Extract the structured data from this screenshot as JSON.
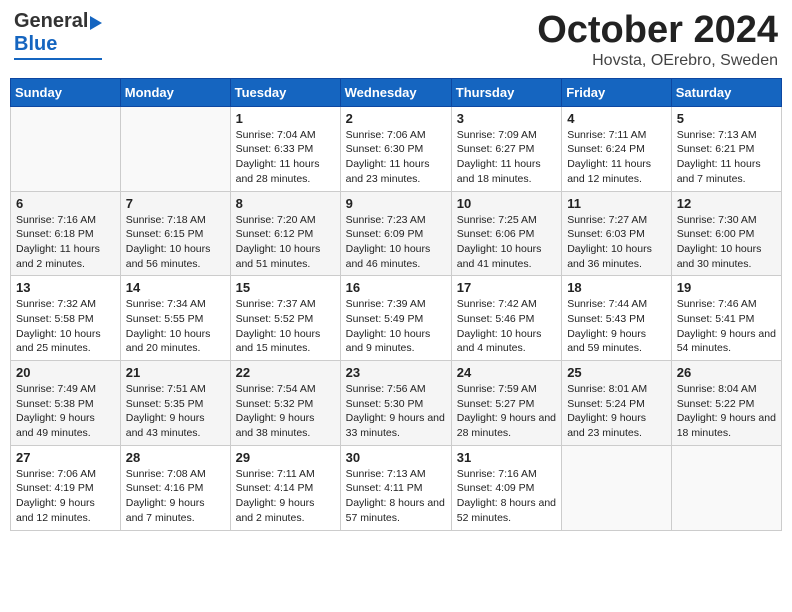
{
  "header": {
    "logo_general": "General",
    "logo_blue": "Blue",
    "month_title": "October 2024",
    "subtitle": "Hovsta, OErebro, Sweden"
  },
  "calendar": {
    "days_of_week": [
      "Sunday",
      "Monday",
      "Tuesday",
      "Wednesday",
      "Thursday",
      "Friday",
      "Saturday"
    ],
    "weeks": [
      [
        {
          "day": "",
          "sunrise": "",
          "sunset": "",
          "daylight": ""
        },
        {
          "day": "",
          "sunrise": "",
          "sunset": "",
          "daylight": ""
        },
        {
          "day": "1",
          "sunrise": "Sunrise: 7:04 AM",
          "sunset": "Sunset: 6:33 PM",
          "daylight": "Daylight: 11 hours and 28 minutes."
        },
        {
          "day": "2",
          "sunrise": "Sunrise: 7:06 AM",
          "sunset": "Sunset: 6:30 PM",
          "daylight": "Daylight: 11 hours and 23 minutes."
        },
        {
          "day": "3",
          "sunrise": "Sunrise: 7:09 AM",
          "sunset": "Sunset: 6:27 PM",
          "daylight": "Daylight: 11 hours and 18 minutes."
        },
        {
          "day": "4",
          "sunrise": "Sunrise: 7:11 AM",
          "sunset": "Sunset: 6:24 PM",
          "daylight": "Daylight: 11 hours and 12 minutes."
        },
        {
          "day": "5",
          "sunrise": "Sunrise: 7:13 AM",
          "sunset": "Sunset: 6:21 PM",
          "daylight": "Daylight: 11 hours and 7 minutes."
        }
      ],
      [
        {
          "day": "6",
          "sunrise": "Sunrise: 7:16 AM",
          "sunset": "Sunset: 6:18 PM",
          "daylight": "Daylight: 11 hours and 2 minutes."
        },
        {
          "day": "7",
          "sunrise": "Sunrise: 7:18 AM",
          "sunset": "Sunset: 6:15 PM",
          "daylight": "Daylight: 10 hours and 56 minutes."
        },
        {
          "day": "8",
          "sunrise": "Sunrise: 7:20 AM",
          "sunset": "Sunset: 6:12 PM",
          "daylight": "Daylight: 10 hours and 51 minutes."
        },
        {
          "day": "9",
          "sunrise": "Sunrise: 7:23 AM",
          "sunset": "Sunset: 6:09 PM",
          "daylight": "Daylight: 10 hours and 46 minutes."
        },
        {
          "day": "10",
          "sunrise": "Sunrise: 7:25 AM",
          "sunset": "Sunset: 6:06 PM",
          "daylight": "Daylight: 10 hours and 41 minutes."
        },
        {
          "day": "11",
          "sunrise": "Sunrise: 7:27 AM",
          "sunset": "Sunset: 6:03 PM",
          "daylight": "Daylight: 10 hours and 36 minutes."
        },
        {
          "day": "12",
          "sunrise": "Sunrise: 7:30 AM",
          "sunset": "Sunset: 6:00 PM",
          "daylight": "Daylight: 10 hours and 30 minutes."
        }
      ],
      [
        {
          "day": "13",
          "sunrise": "Sunrise: 7:32 AM",
          "sunset": "Sunset: 5:58 PM",
          "daylight": "Daylight: 10 hours and 25 minutes."
        },
        {
          "day": "14",
          "sunrise": "Sunrise: 7:34 AM",
          "sunset": "Sunset: 5:55 PM",
          "daylight": "Daylight: 10 hours and 20 minutes."
        },
        {
          "day": "15",
          "sunrise": "Sunrise: 7:37 AM",
          "sunset": "Sunset: 5:52 PM",
          "daylight": "Daylight: 10 hours and 15 minutes."
        },
        {
          "day": "16",
          "sunrise": "Sunrise: 7:39 AM",
          "sunset": "Sunset: 5:49 PM",
          "daylight": "Daylight: 10 hours and 9 minutes."
        },
        {
          "day": "17",
          "sunrise": "Sunrise: 7:42 AM",
          "sunset": "Sunset: 5:46 PM",
          "daylight": "Daylight: 10 hours and 4 minutes."
        },
        {
          "day": "18",
          "sunrise": "Sunrise: 7:44 AM",
          "sunset": "Sunset: 5:43 PM",
          "daylight": "Daylight: 9 hours and 59 minutes."
        },
        {
          "day": "19",
          "sunrise": "Sunrise: 7:46 AM",
          "sunset": "Sunset: 5:41 PM",
          "daylight": "Daylight: 9 hours and 54 minutes."
        }
      ],
      [
        {
          "day": "20",
          "sunrise": "Sunrise: 7:49 AM",
          "sunset": "Sunset: 5:38 PM",
          "daylight": "Daylight: 9 hours and 49 minutes."
        },
        {
          "day": "21",
          "sunrise": "Sunrise: 7:51 AM",
          "sunset": "Sunset: 5:35 PM",
          "daylight": "Daylight: 9 hours and 43 minutes."
        },
        {
          "day": "22",
          "sunrise": "Sunrise: 7:54 AM",
          "sunset": "Sunset: 5:32 PM",
          "daylight": "Daylight: 9 hours and 38 minutes."
        },
        {
          "day": "23",
          "sunrise": "Sunrise: 7:56 AM",
          "sunset": "Sunset: 5:30 PM",
          "daylight": "Daylight: 9 hours and 33 minutes."
        },
        {
          "day": "24",
          "sunrise": "Sunrise: 7:59 AM",
          "sunset": "Sunset: 5:27 PM",
          "daylight": "Daylight: 9 hours and 28 minutes."
        },
        {
          "day": "25",
          "sunrise": "Sunrise: 8:01 AM",
          "sunset": "Sunset: 5:24 PM",
          "daylight": "Daylight: 9 hours and 23 minutes."
        },
        {
          "day": "26",
          "sunrise": "Sunrise: 8:04 AM",
          "sunset": "Sunset: 5:22 PM",
          "daylight": "Daylight: 9 hours and 18 minutes."
        }
      ],
      [
        {
          "day": "27",
          "sunrise": "Sunrise: 7:06 AM",
          "sunset": "Sunset: 4:19 PM",
          "daylight": "Daylight: 9 hours and 12 minutes."
        },
        {
          "day": "28",
          "sunrise": "Sunrise: 7:08 AM",
          "sunset": "Sunset: 4:16 PM",
          "daylight": "Daylight: 9 hours and 7 minutes."
        },
        {
          "day": "29",
          "sunrise": "Sunrise: 7:11 AM",
          "sunset": "Sunset: 4:14 PM",
          "daylight": "Daylight: 9 hours and 2 minutes."
        },
        {
          "day": "30",
          "sunrise": "Sunrise: 7:13 AM",
          "sunset": "Sunset: 4:11 PM",
          "daylight": "Daylight: 8 hours and 57 minutes."
        },
        {
          "day": "31",
          "sunrise": "Sunrise: 7:16 AM",
          "sunset": "Sunset: 4:09 PM",
          "daylight": "Daylight: 8 hours and 52 minutes."
        },
        {
          "day": "",
          "sunrise": "",
          "sunset": "",
          "daylight": ""
        },
        {
          "day": "",
          "sunrise": "",
          "sunset": "",
          "daylight": ""
        }
      ]
    ]
  }
}
